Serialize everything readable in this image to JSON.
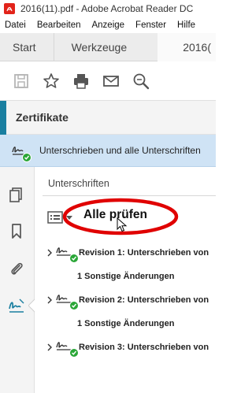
{
  "window": {
    "title": "2016(11).pdf - Adobe Acrobat Reader DC"
  },
  "menubar": {
    "items": [
      "Datei",
      "Bearbeiten",
      "Anzeige",
      "Fenster",
      "Hilfe"
    ]
  },
  "tabs": {
    "start": "Start",
    "tools": "Werkzeuge",
    "document": "2016("
  },
  "toolbar": {
    "icons": [
      "save-icon",
      "star-icon",
      "print-icon",
      "mail-icon",
      "zoom-icon"
    ]
  },
  "panel_header": {
    "label": "Zertifikate"
  },
  "banner": {
    "text": "Unterschrieben und alle Unterschriften"
  },
  "signatures_panel": {
    "title": "Unterschriften",
    "verify_all": "Alle prüfen",
    "revisions": [
      {
        "label": "Revision 1: Unterschrieben von",
        "sub": "1 Sonstige Änderungen"
      },
      {
        "label": "Revision 2: Unterschrieben von",
        "sub": "1 Sonstige Änderungen"
      },
      {
        "label": "Revision 3: Unterschrieben von",
        "sub": ""
      }
    ]
  },
  "colors": {
    "accent": "#1a7fa0",
    "banner_bg": "#cfe3f5",
    "valid_green": "#2aa637",
    "annotation_red": "#e00000"
  }
}
